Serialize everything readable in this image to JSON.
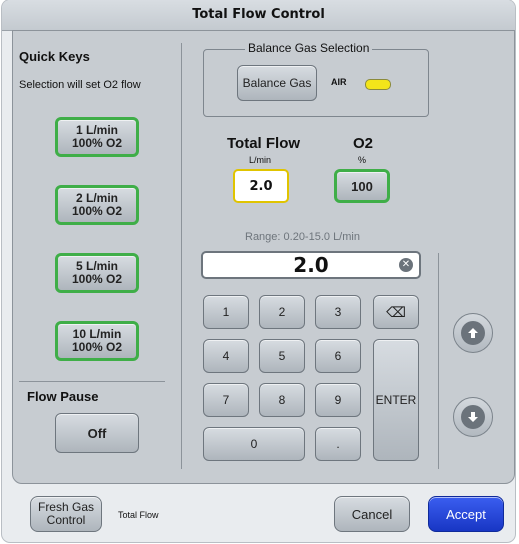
{
  "title": "Total Flow Control",
  "quick_keys": {
    "heading": "Quick Keys",
    "subheading": "Selection will set O2 flow",
    "items": [
      {
        "line1": "1 L/min",
        "line2": "100% O2"
      },
      {
        "line1": "2 L/min",
        "line2": "100% O2"
      },
      {
        "line1": "5 L/min",
        "line2": "100% O2"
      },
      {
        "line1": "10 L/min",
        "line2": "100% O2"
      }
    ]
  },
  "flow_pause": {
    "label": "Flow Pause",
    "button": "Off"
  },
  "balance_gas": {
    "group_label": "Balance Gas Selection",
    "button": "Balance Gas",
    "value": "AIR",
    "indicator_color": "#f3e51a"
  },
  "total_flow": {
    "label": "Total Flow",
    "unit": "L/min",
    "value": "2.0"
  },
  "o2": {
    "label": "O2",
    "unit": "%",
    "value": "100"
  },
  "range_text": "Range: 0.20-15.0 L/min",
  "entry": {
    "value": "2.0"
  },
  "keypad": {
    "keys": [
      "1",
      "2",
      "3",
      "4",
      "5",
      "6",
      "7",
      "8",
      "9",
      "0",
      "."
    ],
    "enter": "ENTER"
  },
  "footer": {
    "fresh_gas_button": "Fresh Gas Control",
    "fresh_gas_line1": "Fresh Gas",
    "fresh_gas_line2": "Control",
    "status": "Total Flow",
    "cancel": "Cancel",
    "accept": "Accept"
  },
  "colors": {
    "accent_green": "#3fae48",
    "accept_blue": "#2243d6",
    "highlight_yellow": "#f3e51a"
  }
}
